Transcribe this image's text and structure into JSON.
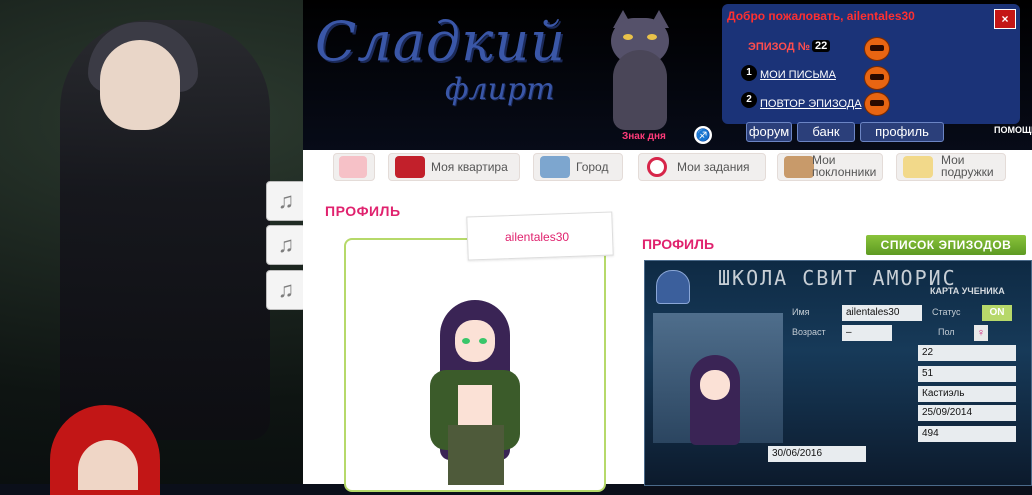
{
  "header": {
    "logo_main": "Сладкий",
    "logo_sub": "флирт",
    "sign_of_day": "Знак дня",
    "welcome": "Добро пожаловать, ailentales30",
    "close_icon": "×",
    "episode_label": "ЭПИЗОД №",
    "episode_number": "22",
    "link1_num": "1",
    "link1_label": "МОИ ПИСЬМА",
    "link2_num": "2",
    "link2_label": "ПОВТОР ЭПИЗОДА",
    "forum": "форум",
    "bank": "банк",
    "profile": "профиль",
    "help": "ПОМОЩЬ"
  },
  "music": {
    "icon": "♫"
  },
  "nav": {
    "items": [
      {
        "label": "",
        "icon": "home-icon"
      },
      {
        "label": "Моя квартира",
        "icon": "sofa-icon"
      },
      {
        "label": "Город",
        "icon": "city-icon"
      },
      {
        "label": "Мои задания",
        "icon": "target-icon"
      },
      {
        "label_1": "Мои",
        "label_2": "поклонники",
        "icon": "boy-icon"
      },
      {
        "label_1": "Мои",
        "label_2": "подружки",
        "icon": "girl-icon"
      }
    ]
  },
  "main": {
    "profile_title": "ПРОФИЛЬ",
    "username": "ailentales30",
    "profile_title2": "ПРОФИЛЬ",
    "episodes_button": "СПИСОК ЭПИЗОДОВ"
  },
  "card": {
    "title": "ШКОЛА СВИТ АМОРИС",
    "subtitle": "КАРТА УЧЕНИКА",
    "label_name": "Имя",
    "name": "ailentales30",
    "label_status": "Статус",
    "status": "ON",
    "label_age": "Возраст",
    "age": "–",
    "label_gender": "Пол",
    "gender": "♀",
    "val_1": "22",
    "val_2": "51",
    "val_3": "Кастиэль",
    "val_4": "25/09/2014",
    "val_5": "494",
    "date": "30/06/2016"
  },
  "colors": {
    "accent_pink": "#e0226e",
    "green_button": "#6fae2b",
    "header_blue": "#1b3378"
  }
}
